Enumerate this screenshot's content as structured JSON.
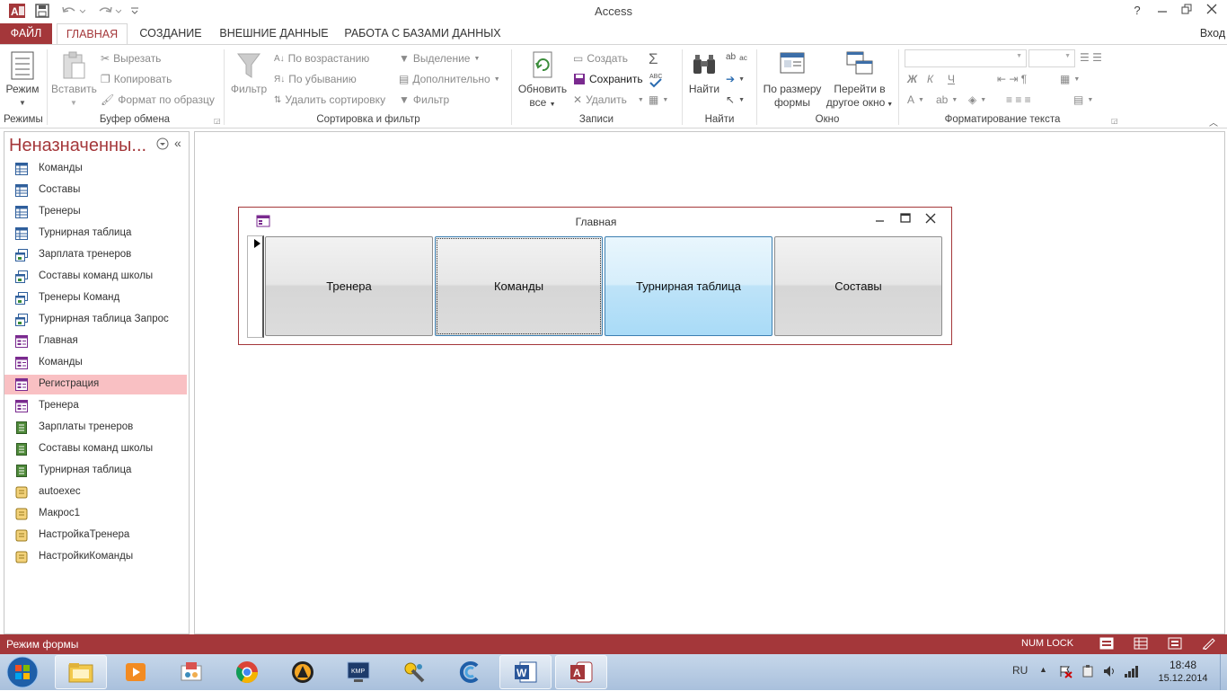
{
  "window": {
    "title": "Access"
  },
  "tabs": [
    "ФАЙЛ",
    "ГЛАВНАЯ",
    "СОЗДАНИЕ",
    "ВНЕШНИЕ ДАННЫЕ",
    "РАБОТА С БАЗАМИ ДАННЫХ"
  ],
  "signin": "Вход",
  "ribbon": {
    "views": {
      "mode": "Режим",
      "label": "Режимы"
    },
    "clipboard": {
      "paste": "Вставить",
      "cut": "Вырезать",
      "copy": "Копировать",
      "format_painter": "Формат по образцу",
      "label": "Буфер обмена"
    },
    "sort_filter": {
      "filter": "Фильтр",
      "ascending": "По возрастанию",
      "descending": "По убыванию",
      "remove_sort": "Удалить сортировку",
      "selection": "Выделение",
      "advanced": "Дополнительно",
      "toggle_filter": "Фильтр",
      "label": "Сортировка и фильтр"
    },
    "records": {
      "refresh_line1": "Обновить",
      "refresh_line2": "все",
      "new": "Создать",
      "save": "Сохранить",
      "delete": "Удалить",
      "label": "Записи"
    },
    "find": {
      "find": "Найти",
      "label": "Найти"
    },
    "window": {
      "fit_line1": "По размеру",
      "fit_line2": "формы",
      "switch_line1": "Перейти в",
      "switch_line2": "другое окно",
      "label": "Окно"
    },
    "text_formatting": {
      "bold": "Ж",
      "italic": "К",
      "underline": "Ч",
      "label": "Форматирование текста"
    }
  },
  "nav": {
    "title": "Неназначенны...",
    "items": [
      {
        "label": "Команды",
        "type": "table"
      },
      {
        "label": "Составы",
        "type": "table"
      },
      {
        "label": "Тренеры",
        "type": "table"
      },
      {
        "label": "Турнирная таблица",
        "type": "table"
      },
      {
        "label": "Зарплата тренеров",
        "type": "query"
      },
      {
        "label": "Составы команд школы",
        "type": "query"
      },
      {
        "label": "Тренеры Команд",
        "type": "query"
      },
      {
        "label": "Турнирная таблица Запрос",
        "type": "query"
      },
      {
        "label": "Главная",
        "type": "form"
      },
      {
        "label": "Команды",
        "type": "form"
      },
      {
        "label": "Регистрация",
        "type": "form",
        "selected": true
      },
      {
        "label": "Тренера",
        "type": "form"
      },
      {
        "label": "Зарплаты тренеров",
        "type": "report"
      },
      {
        "label": "Составы команд школы",
        "type": "report"
      },
      {
        "label": "Турнирная таблица",
        "type": "report"
      },
      {
        "label": "autoexec",
        "type": "macro"
      },
      {
        "label": "Макрос1",
        "type": "macro"
      },
      {
        "label": "НастройкаТренера",
        "type": "macro"
      },
      {
        "label": "НастройкиКоманды",
        "type": "macro"
      }
    ]
  },
  "form": {
    "title": "Главная",
    "buttons": [
      "Тренера",
      "Команды",
      "Турнирная таблица",
      "Составы"
    ]
  },
  "status": {
    "left": "Режим формы",
    "numlock": "NUM LOCK"
  },
  "taskbar": {
    "lang": "RU",
    "time": "18:48",
    "date": "15.12.2014"
  },
  "colors": {
    "accent": "#a4373a",
    "nav_selected": "#f9c0c3",
    "button_hover": "#bee3f8"
  }
}
